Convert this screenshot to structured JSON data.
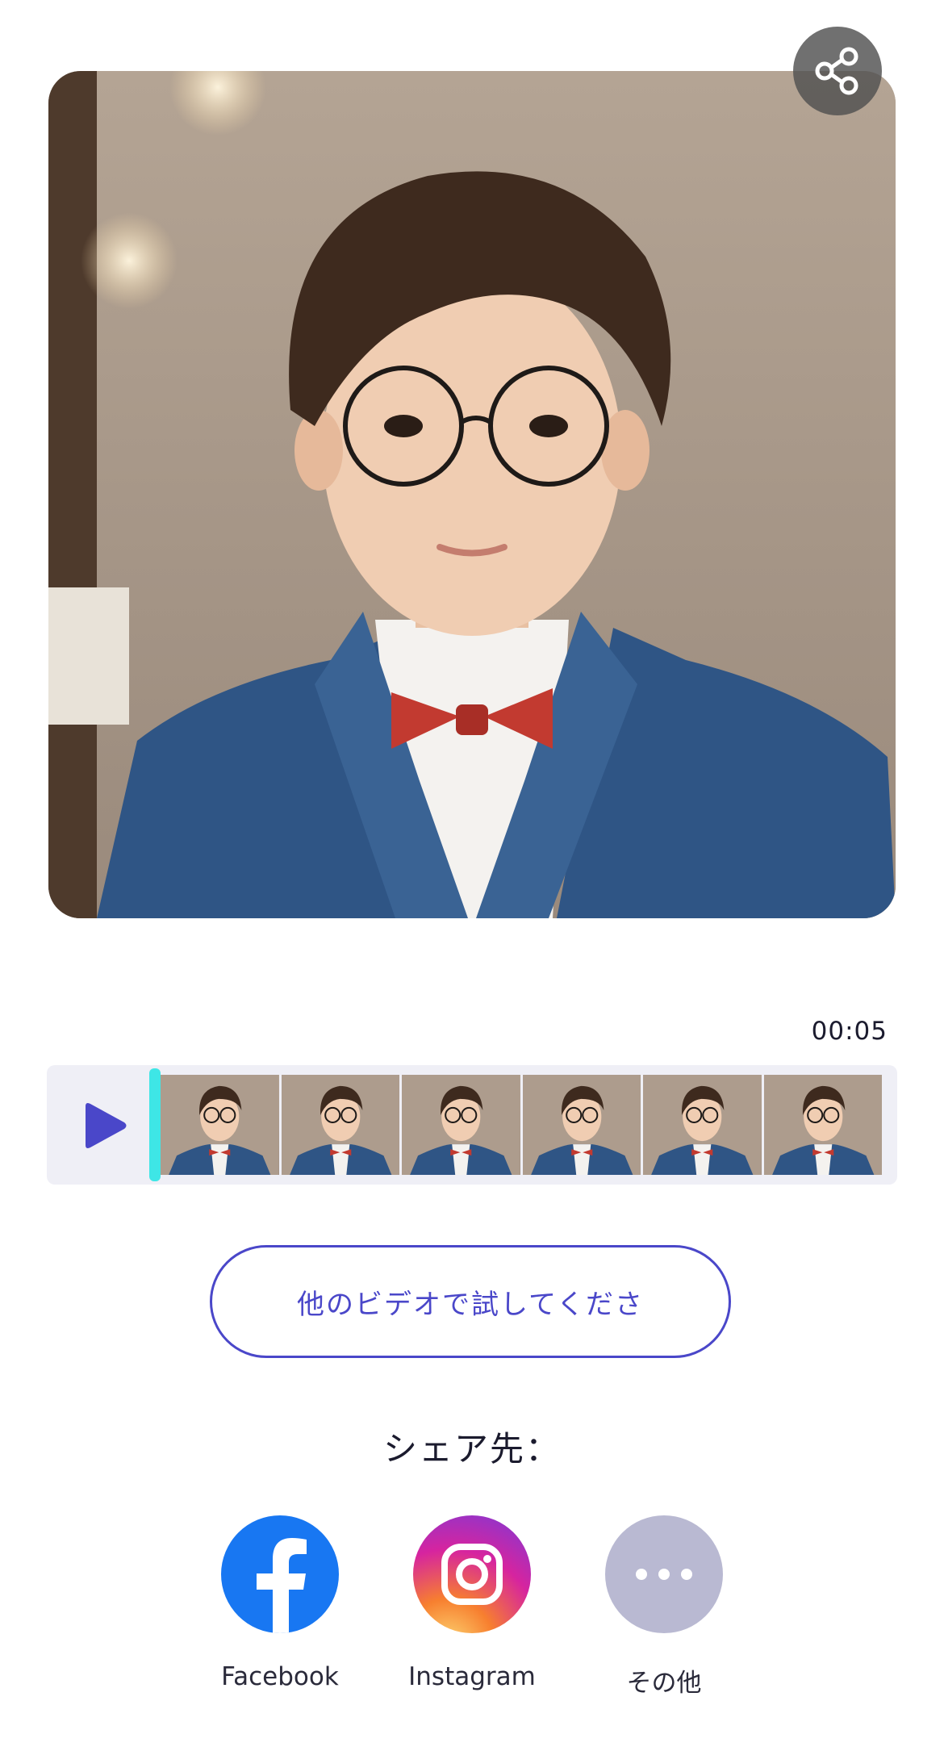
{
  "player": {
    "timecode": "00:05",
    "frame_count": 6
  },
  "actions": {
    "try_other_label": "他のビデオで試してくださ"
  },
  "share": {
    "title": "シェア先：",
    "options": [
      {
        "label": "Facebook",
        "icon": "facebook-icon"
      },
      {
        "label": "Instagram",
        "icon": "instagram-icon"
      },
      {
        "label": "その他",
        "icon": "more-icon"
      }
    ]
  },
  "colors": {
    "accent": "#4a47c9",
    "playhead": "#3ee6e6",
    "facebook": "#1877f2",
    "more": "#b9b9d2"
  }
}
